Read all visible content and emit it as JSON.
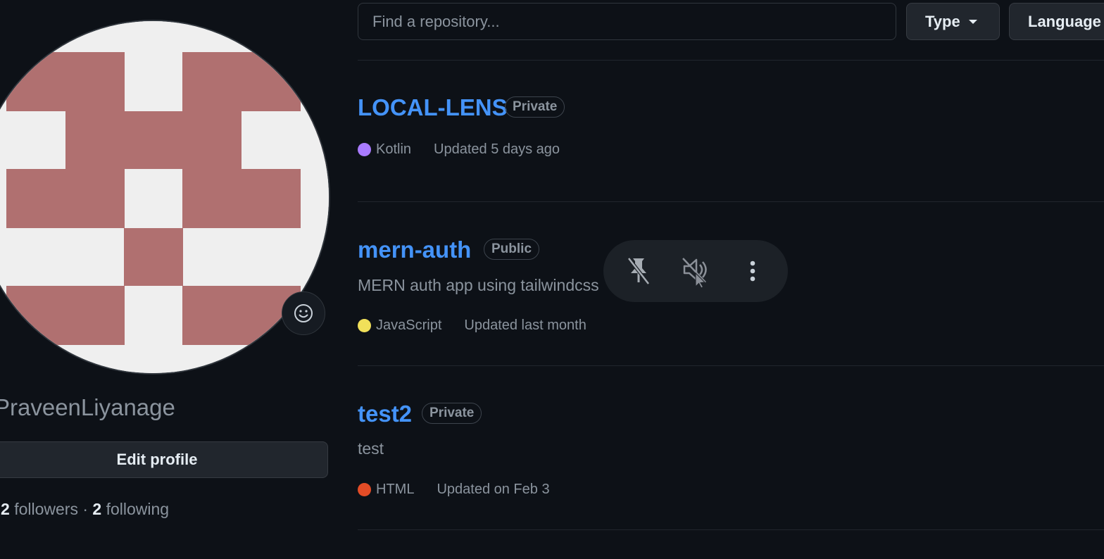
{
  "profile": {
    "username": "PraveenLiyanage",
    "edit_label": "Edit profile",
    "followers_count": "2",
    "followers_label": "followers",
    "separator": "·",
    "following_count": "2",
    "following_label": "following",
    "avatar_color": "#b07070",
    "avatar_bg": "#efefef"
  },
  "filters": {
    "search_placeholder": "Find a repository...",
    "type_label": "Type",
    "language_label": "Language"
  },
  "repos": [
    {
      "name": "LOCAL-LENS",
      "visibility": "Private",
      "description": "",
      "language": "Kotlin",
      "language_color": "#a97bff",
      "updated": "Updated 5 days ago"
    },
    {
      "name": "mern-auth",
      "visibility": "Public",
      "description": "MERN auth app using tailwindcss",
      "language": "JavaScript",
      "language_color": "#f1e05a",
      "updated": "Updated last month"
    },
    {
      "name": "test2",
      "visibility": "Private",
      "description": "test",
      "language": "HTML",
      "language_color": "#e34c26",
      "updated": "Updated on Feb 3"
    }
  ],
  "overlay": {
    "icons": [
      "unpin-icon",
      "mute-icon",
      "more-vertical-icon"
    ]
  },
  "colors": {
    "background": "#0d1117",
    "link": "#4493f8",
    "muted": "#8b949e",
    "border": "#30363d"
  }
}
